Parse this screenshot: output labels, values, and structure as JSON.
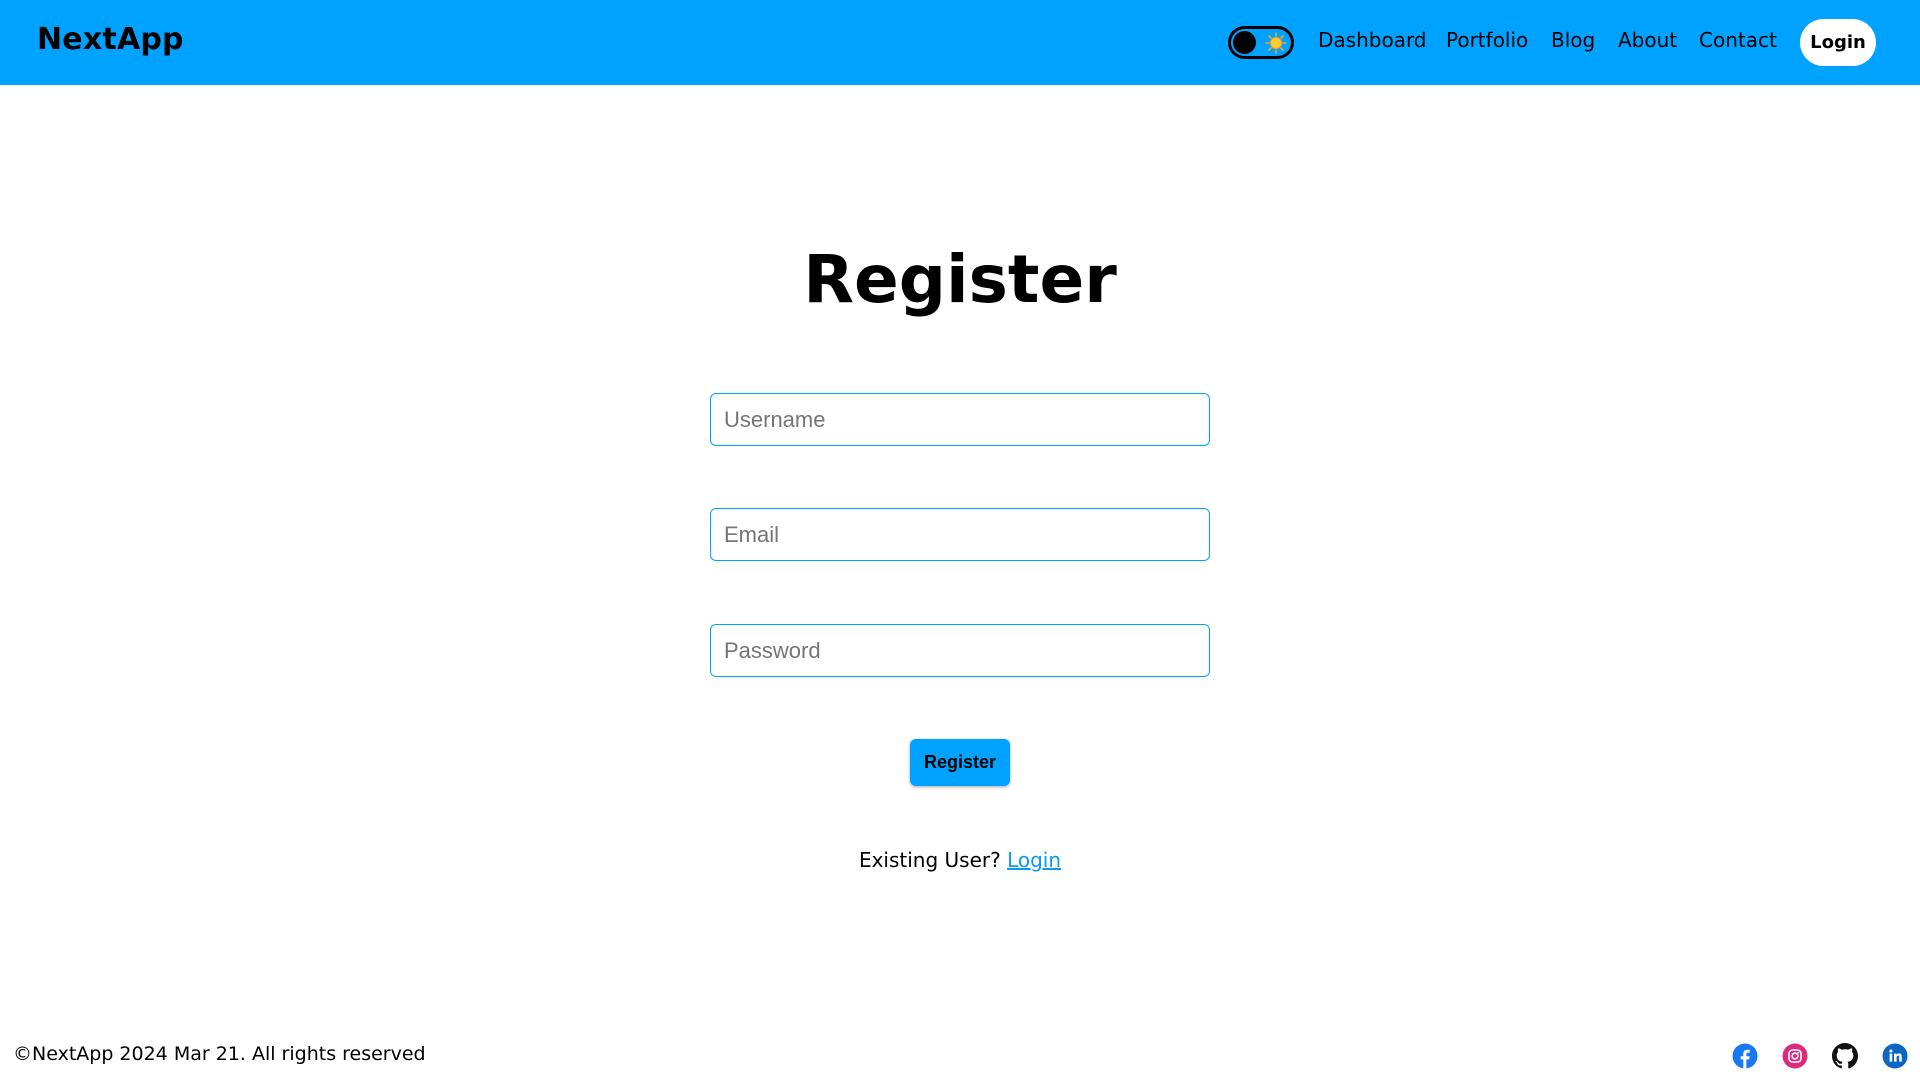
{
  "brand": "NextApp",
  "nav": {
    "toggle_icon": "sun-icon",
    "links": [
      "Dashboard",
      "Portfolio",
      "Blog",
      "About",
      "Contact"
    ],
    "login_label": "Login"
  },
  "main": {
    "title": "Register",
    "username_placeholder": "Username",
    "email_placeholder": "Email",
    "password_placeholder": "Password",
    "register_label": "Register",
    "existing_text": "Existing User?",
    "login_link": "Login"
  },
  "footer": {
    "copyright": "©NextApp 2024 Mar 21. All rights reserved",
    "social_icons": [
      "facebook-icon",
      "instagram-icon",
      "github-icon",
      "linkedin-icon"
    ]
  },
  "colors": {
    "accent": "#00a2ff",
    "link": "#0a9bf0",
    "background": "#ffffff"
  }
}
